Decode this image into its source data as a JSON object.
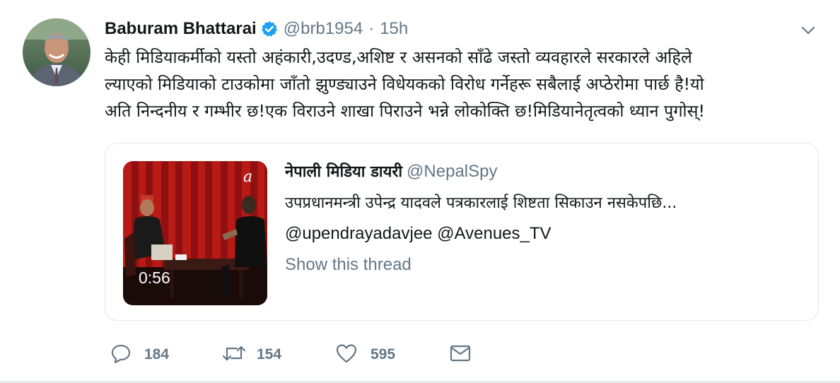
{
  "author": {
    "name": "Baburam Bhattarai",
    "verified": true,
    "handle": "@brb1954",
    "separator": "·",
    "time": "15h"
  },
  "tweet_text_lines": [
    "केही मिडियाकर्मीको यस्तो अहंकारी,उदण्ड,अशिष्ट र असनको साँढे जस्तो व्यवहारले सरकारले अहिले",
    "ल्याएको मिडियाको टाउकोमा जाँतो झुण्ड्याउने विधेयकको विरोध गर्नेहरू सबैलाई अप्ठेरोमा पार्छ है!यो",
    "अति निन्दनीय र गम्भीर छ!एक विराउने शाखा पिराउने भन्ने लोकोक्ति छ!मिडियानेतृत्वको ध्यान पुगोस्!"
  ],
  "quoted": {
    "name": "नेपाली मिडिया डायरी",
    "handle": "@NepalSpy",
    "text": "उपप्रधानमन्त्री उपेन्द्र यादवले पत्रकारलाई शिष्टता सिकाउन नसकेपछि...",
    "mentions": "@upendrayadavjee @Avenues_TV",
    "show_thread": "Show this thread",
    "video_duration": "0:56",
    "thumbnail_overlay": "a"
  },
  "actions": {
    "reply_count": "184",
    "retweet_count": "154",
    "like_count": "595"
  },
  "icons": {
    "verified": "verified-badge-icon",
    "caret": "chevron-down-icon",
    "reply": "reply-icon",
    "retweet": "retweet-icon",
    "like": "heart-icon",
    "dm": "envelope-icon"
  },
  "colors": {
    "accent": "#1da1f2",
    "secondary_text": "#657786",
    "primary_text": "#14171a",
    "border": "#e1e8ed"
  }
}
